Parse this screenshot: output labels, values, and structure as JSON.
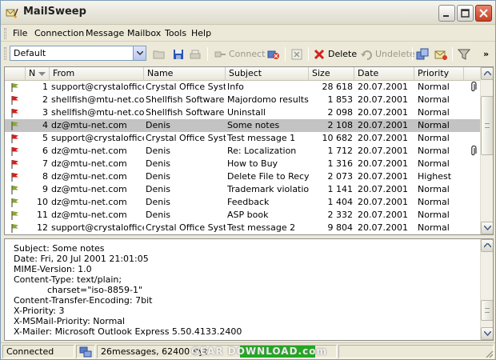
{
  "window": {
    "title": "MailSweep"
  },
  "menu": [
    "File",
    "Connection",
    "Message",
    "Mailbox",
    "Tools",
    "Help"
  ],
  "toolbar": {
    "account": "Default",
    "connect_label": "Connect",
    "delete_label": "Delete",
    "undelete_label": "Undelete",
    "overflow": "»"
  },
  "list": {
    "headers": {
      "n": "N",
      "from": "From",
      "name": "Name",
      "subject": "Subject",
      "size": "Size",
      "date": "Date",
      "priority": "Priority"
    },
    "rows": [
      {
        "n": "1",
        "from": "support@crystaloffice.co",
        "name": "Crystal Office System",
        "subject": "Info",
        "size": "28 618",
        "date": "20.07.2001",
        "priority": "Normal",
        "flag": "green",
        "attach": true
      },
      {
        "n": "2",
        "from": "shellfish@mtu-net.com",
        "name": "Shellfish Software su",
        "subject": "Majordomo results",
        "size": "1 853",
        "date": "20.07.2001",
        "priority": "Normal",
        "flag": "red",
        "attach": false
      },
      {
        "n": "3",
        "from": "shellfish@mtu-net.com",
        "name": "Shellfish Software su",
        "subject": "Uninstall",
        "size": "2 098",
        "date": "20.07.2001",
        "priority": "Normal",
        "flag": "red",
        "attach": false
      },
      {
        "n": "4",
        "from": "dz@mtu-net.com",
        "name": "Denis",
        "subject": "Some notes",
        "size": "2 108",
        "date": "20.07.2001",
        "priority": "Normal",
        "flag": "green",
        "attach": false,
        "selected": true
      },
      {
        "n": "5",
        "from": "support@crystaloffice.co",
        "name": "Crystal Office System",
        "subject": "Test message 1",
        "size": "10 682",
        "date": "20.07.2001",
        "priority": "Normal",
        "flag": "red",
        "attach": false
      },
      {
        "n": "6",
        "from": "dz@mtu-net.com",
        "name": "Denis",
        "subject": "Re: Localization",
        "size": "1 712",
        "date": "20.07.2001",
        "priority": "Normal",
        "flag": "red",
        "attach": true
      },
      {
        "n": "7",
        "from": "dz@mtu-net.com",
        "name": "Denis",
        "subject": "How to Buy",
        "size": "1 316",
        "date": "20.07.2001",
        "priority": "Normal",
        "flag": "red",
        "attach": false
      },
      {
        "n": "8",
        "from": "dz@mtu-net.com",
        "name": "Denis",
        "subject": "Delete File to Recycle",
        "size": "2 073",
        "date": "20.07.2001",
        "priority": "Highest",
        "flag": "red",
        "attach": false
      },
      {
        "n": "9",
        "from": "dz@mtu-net.com",
        "name": "Denis",
        "subject": "Trademark violation",
        "size": "1 141",
        "date": "20.07.2001",
        "priority": "Normal",
        "flag": "green",
        "attach": false
      },
      {
        "n": "10",
        "from": "dz@mtu-net.com",
        "name": "Denis",
        "subject": "Feedback",
        "size": "1 404",
        "date": "20.07.2001",
        "priority": "Normal",
        "flag": "green",
        "attach": false
      },
      {
        "n": "11",
        "from": "dz@mtu-net.com",
        "name": "Denis",
        "subject": "ASP book",
        "size": "2 332",
        "date": "20.07.2001",
        "priority": "Normal",
        "flag": "green",
        "attach": false
      },
      {
        "n": "12",
        "from": "support@crystaloffice.co",
        "name": "Crystal Office System",
        "subject": "Test message 2",
        "size": "9 804",
        "date": "20.07.2001",
        "priority": "Normal",
        "flag": "green",
        "attach": false
      }
    ]
  },
  "preview": {
    "lines": [
      "Subject: Some notes",
      "Date: Fri, 20 Jul 2001 21:01:05",
      "MIME-Version: 1.0",
      "Content-Type: text/plain;",
      "            charset=\"iso-8859-1\"",
      "Content-Transfer-Encoding: 7bit",
      "X-Priority: 3",
      "X-MSMail-Priority: Normal",
      "X-Mailer: Microsoft Outlook Express 5.50.4133.2400"
    ]
  },
  "status": {
    "connection": "Connected",
    "info": "26messages, 62400 Byt",
    "watermark": "GEAR DOWNLOAD.com"
  },
  "colors": {
    "flag_red": "#d81e1e",
    "flag_green": "#8aa830",
    "selected_row": "#c3c3c3",
    "progress": "#1faa1f"
  }
}
